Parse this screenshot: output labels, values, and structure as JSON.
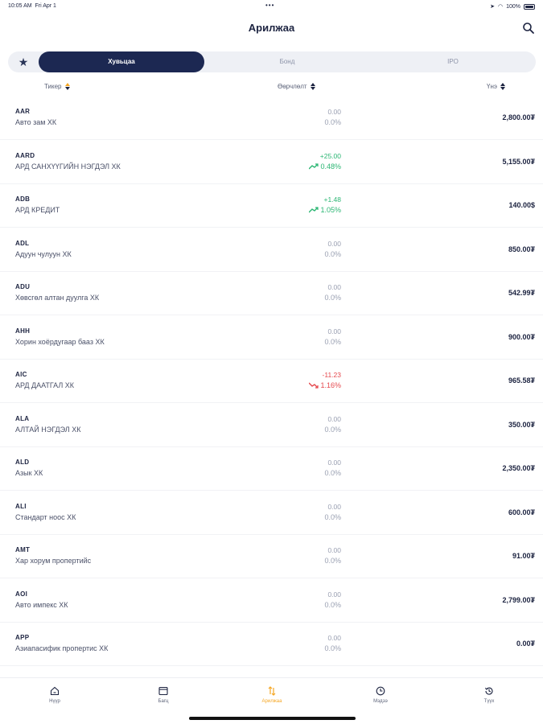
{
  "status_bar": {
    "time": "10:05 AM",
    "date": "Fri Apr 1",
    "dots": "•••",
    "battery": "100%"
  },
  "header": {
    "title": "Арилжаа"
  },
  "tabs": [
    {
      "label": "Хувьцаа",
      "active": true
    },
    {
      "label": "Бонд",
      "active": false
    },
    {
      "label": "IPO",
      "active": false
    }
  ],
  "columns": {
    "ticker": "Тикер",
    "change": "Өөрчлөлт",
    "price": "Үнэ"
  },
  "rows": [
    {
      "ticker": "AAR",
      "name": "Авто зам ХК",
      "change": "0.00",
      "pct": "0.0%",
      "price": "2,800.00₮",
      "trend": "flat"
    },
    {
      "ticker": "AARD",
      "name": "АРД САНХҮҮГИЙН НЭГДЭЛ ХК",
      "change": "+25.00",
      "pct": "0.48%",
      "price": "5,155.00₮",
      "trend": "up"
    },
    {
      "ticker": "ADB",
      "name": "АРД КРЕДИТ",
      "change": "+1.48",
      "pct": "1.05%",
      "price": "140.00$",
      "trend": "up"
    },
    {
      "ticker": "ADL",
      "name": "Адуун чулуун ХК",
      "change": "0.00",
      "pct": "0.0%",
      "price": "850.00₮",
      "trend": "flat"
    },
    {
      "ticker": "ADU",
      "name": "Хөвсгөл алтан дуулга ХК",
      "change": "0.00",
      "pct": "0.0%",
      "price": "542.99₮",
      "trend": "flat"
    },
    {
      "ticker": "AHH",
      "name": "Хорин хоёрдугаар бааз ХК",
      "change": "0.00",
      "pct": "0.0%",
      "price": "900.00₮",
      "trend": "flat"
    },
    {
      "ticker": "AIC",
      "name": "АРД ДААТГАЛ ХК",
      "change": "-11.23",
      "pct": "1.16%",
      "price": "965.58₮",
      "trend": "down"
    },
    {
      "ticker": "ALA",
      "name": "АЛТАЙ НЭГДЭЛ ХК",
      "change": "0.00",
      "pct": "0.0%",
      "price": "350.00₮",
      "trend": "flat"
    },
    {
      "ticker": "ALD",
      "name": "Азык ХК",
      "change": "0.00",
      "pct": "0.0%",
      "price": "2,350.00₮",
      "trend": "flat"
    },
    {
      "ticker": "ALI",
      "name": "Стандарт ноос ХК",
      "change": "0.00",
      "pct": "0.0%",
      "price": "600.00₮",
      "trend": "flat"
    },
    {
      "ticker": "AMT",
      "name": "Хар хорум пропертийс",
      "change": "0.00",
      "pct": "0.0%",
      "price": "91.00₮",
      "trend": "flat"
    },
    {
      "ticker": "AOI",
      "name": "Авто импекс ХК",
      "change": "0.00",
      "pct": "0.0%",
      "price": "2,799.00₮",
      "trend": "flat"
    },
    {
      "ticker": "APP",
      "name": "Азиапасифик пропертис ХК",
      "change": "0.00",
      "pct": "0.0%",
      "price": "0.00₮",
      "trend": "flat"
    }
  ],
  "bottom_nav": [
    {
      "label": "Нүүр",
      "icon": "home-icon",
      "active": false
    },
    {
      "label": "Багц",
      "icon": "portfolio-icon",
      "active": false
    },
    {
      "label": "Арилжаа",
      "icon": "trade-icon",
      "active": true
    },
    {
      "label": "Мэдээ",
      "icon": "news-icon",
      "active": false
    },
    {
      "label": "Түүх",
      "icon": "history-icon",
      "active": false
    }
  ],
  "colors": {
    "accent": "#1c2852",
    "up": "#2bb673",
    "down": "#e5484d",
    "nav_active": "#f5a623"
  }
}
